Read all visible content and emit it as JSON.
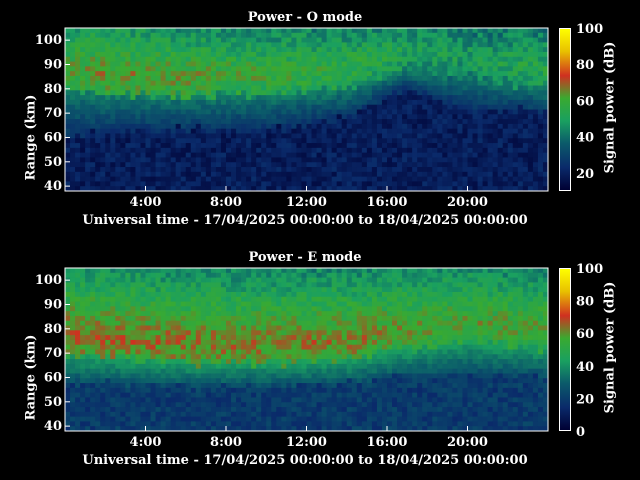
{
  "panels": [
    {
      "title": "Power - O mode",
      "ylabel": "Range (km)",
      "xlabel": "Universal time - 17/04/2025 00:00:00 to 18/04/2025 00:00:00",
      "colorbar_label": "Signal power (dB)"
    },
    {
      "title": "Power - E mode",
      "ylabel": "Range (km)",
      "xlabel": "Universal time - 17/04/2025 00:00:00 to 18/04/2025 00:00:00",
      "colorbar_label": "Signal power (dB)"
    }
  ],
  "chart_data": [
    {
      "type": "heatmap",
      "title": "Power - O mode",
      "xlabel": "Universal time - 17/04/2025 00:00:00 to 18/04/2025 00:00:00",
      "ylabel": "Range (km)",
      "xlim": [
        "00:00",
        "24:00"
      ],
      "ylim": [
        38,
        105
      ],
      "x_ticks": [
        "4:00",
        "8:00",
        "12:00",
        "16:00",
        "20:00"
      ],
      "y_ticks": [
        40,
        50,
        60,
        70,
        80,
        90,
        100
      ],
      "colorbar": {
        "label": "Signal power (dB)",
        "range": [
          10,
          100
        ],
        "ticks": [
          20,
          40,
          60,
          80,
          100
        ]
      },
      "profile": [
        {
          "time_h": 0,
          "noise_top_km": 60,
          "layer_bottom_km": 80,
          "peak_dB": 62
        },
        {
          "time_h": 2,
          "noise_top_km": 62,
          "layer_bottom_km": 78,
          "peak_dB": 65
        },
        {
          "time_h": 6,
          "noise_top_km": 63,
          "layer_bottom_km": 77,
          "peak_dB": 63
        },
        {
          "time_h": 10,
          "noise_top_km": 63,
          "layer_bottom_km": 78,
          "peak_dB": 60
        },
        {
          "time_h": 14,
          "noise_top_km": 68,
          "layer_bottom_km": 80,
          "peak_dB": 58
        },
        {
          "time_h": 17,
          "noise_top_km": 80,
          "layer_bottom_km": 88,
          "peak_dB": 52
        },
        {
          "time_h": 20,
          "noise_top_km": 72,
          "layer_bottom_km": 85,
          "peak_dB": 50
        },
        {
          "time_h": 24,
          "noise_top_km": 70,
          "layer_bottom_km": 80,
          "peak_dB": 55
        }
      ]
    },
    {
      "type": "heatmap",
      "title": "Power - E mode",
      "xlabel": "Universal time - 17/04/2025 00:00:00 to 18/04/2025 00:00:00",
      "ylabel": "Range (km)",
      "xlim": [
        "00:00",
        "24:00"
      ],
      "ylim": [
        38,
        105
      ],
      "x_ticks": [
        "4:00",
        "8:00",
        "12:00",
        "16:00",
        "20:00"
      ],
      "y_ticks": [
        40,
        50,
        60,
        70,
        80,
        90,
        100
      ],
      "colorbar": {
        "label": "Signal power (dB)",
        "range": [
          0,
          100
        ],
        "ticks": [
          0,
          20,
          40,
          60,
          80,
          100
        ]
      },
      "profile": [
        {
          "time_h": 0,
          "noise_top_km": 58,
          "layer_bottom_km": 70,
          "peak_dB": 65
        },
        {
          "time_h": 2,
          "noise_top_km": 57,
          "layer_bottom_km": 68,
          "peak_dB": 66
        },
        {
          "time_h": 6,
          "noise_top_km": 56,
          "layer_bottom_km": 66,
          "peak_dB": 65
        },
        {
          "time_h": 10,
          "noise_top_km": 56,
          "layer_bottom_km": 66,
          "peak_dB": 64
        },
        {
          "time_h": 14,
          "noise_top_km": 57,
          "layer_bottom_km": 67,
          "peak_dB": 64
        },
        {
          "time_h": 17,
          "noise_top_km": 60,
          "layer_bottom_km": 72,
          "peak_dB": 60
        },
        {
          "time_h": 20,
          "noise_top_km": 62,
          "layer_bottom_km": 75,
          "peak_dB": 58
        },
        {
          "time_h": 24,
          "noise_top_km": 60,
          "layer_bottom_km": 72,
          "peak_dB": 58
        }
      ]
    }
  ],
  "colors": {
    "background": "#000000",
    "text": "#ffffff",
    "colormap": [
      "#000033",
      "#0a2a6a",
      "#0b5a6a",
      "#1aa060",
      "#3aaa30",
      "#d03020",
      "#e8c000",
      "#ffff00"
    ]
  }
}
